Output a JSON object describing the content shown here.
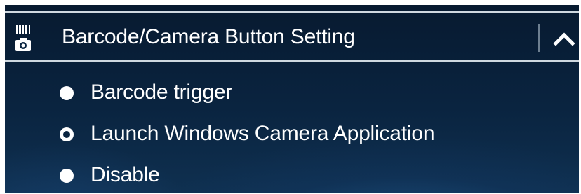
{
  "section": {
    "title": "Barcode/Camera Button Setting",
    "icon": "barcode-camera-icon",
    "collapse_icon": "chevron-up-icon"
  },
  "options": [
    {
      "label": "Barcode trigger",
      "selected": false
    },
    {
      "label": "Launch Windows Camera Application",
      "selected": true
    },
    {
      "label": "Disable",
      "selected": false
    }
  ],
  "colors": {
    "background": "#0a2440",
    "text": "#ffffff",
    "rule": "#cfd8e0"
  }
}
